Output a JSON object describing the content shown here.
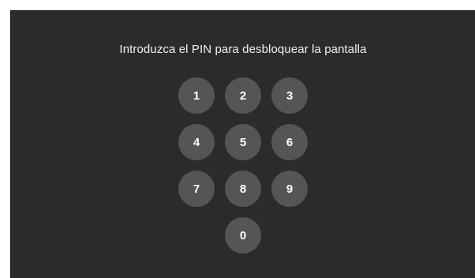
{
  "lock_screen": {
    "prompt": "Introduzca el PIN para desbloquear la pantalla",
    "keypad": {
      "key_1": "1",
      "key_2": "2",
      "key_3": "3",
      "key_4": "4",
      "key_5": "5",
      "key_6": "6",
      "key_7": "7",
      "key_8": "8",
      "key_9": "9",
      "key_0": "0"
    }
  },
  "colors": {
    "background": "#2b2b2b",
    "key_fill": "#555555",
    "text": "#ffffff"
  }
}
